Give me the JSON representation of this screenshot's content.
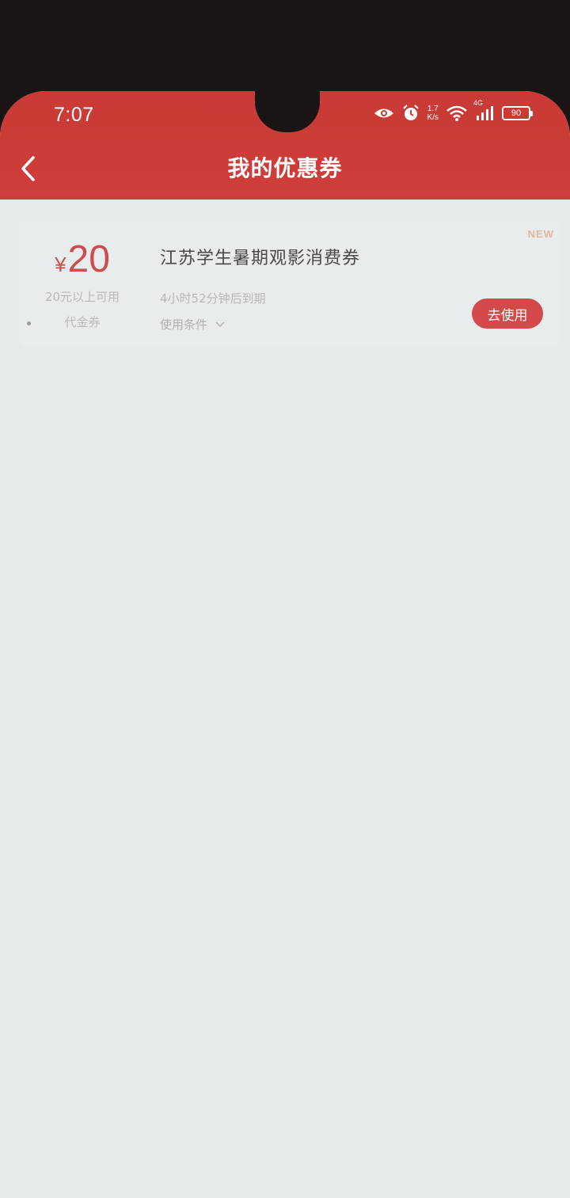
{
  "status_bar": {
    "time": "7:07",
    "net_speed_value": "1.7",
    "net_speed_unit": "K/s",
    "network_type": "4G",
    "battery": "90",
    "icons": [
      "eye-icon",
      "alarm-icon",
      "wifi-icon",
      "signal-icon",
      "battery-icon"
    ]
  },
  "header": {
    "title": "我的优惠券",
    "back_icon": "chevron-left-icon",
    "bg_color": "#cb3b37"
  },
  "coupon": {
    "currency_symbol": "¥",
    "amount": "20",
    "threshold": "20元以上可用",
    "type": "代金券",
    "title": "江苏学生暑期观影消费券",
    "expire": "4小时52分钟后到期",
    "conditions": "使用条件",
    "badge": "NEW",
    "action_label": "去使用",
    "accent_color": "#d44a4b"
  }
}
